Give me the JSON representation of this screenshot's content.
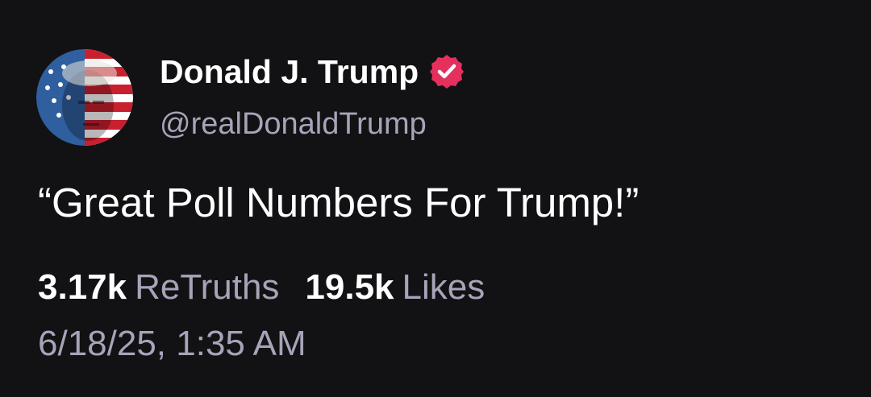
{
  "author": {
    "display_name": "Donald J. Trump",
    "handle": "@realDonaldTrump",
    "verified_icon": "verified-badge-icon",
    "avatar_description": "avatar"
  },
  "post": {
    "text": "“Great Poll Numbers For Trump!”"
  },
  "stats": {
    "retruths_count": "3.17k",
    "retruths_label": "ReTruths",
    "likes_count": "19.5k",
    "likes_label": "Likes"
  },
  "timestamp": "6/18/25, 1:35 AM",
  "colors": {
    "background": "#121113",
    "primary_text": "#ffffff",
    "secondary_text": "#a7a3b8",
    "verified_badge": "#e5305d"
  }
}
